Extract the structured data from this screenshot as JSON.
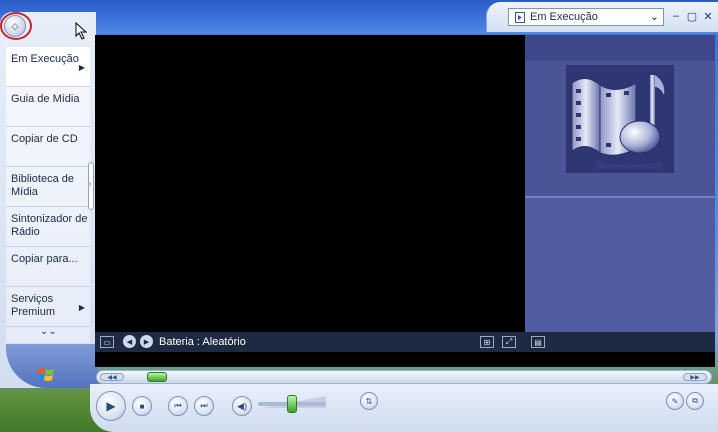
{
  "header": {
    "mode_selected": "Em Execução"
  },
  "taskpane": {
    "items": [
      {
        "label": "Em Execução",
        "has_arrow": true
      },
      {
        "label": "Guia de Mídia",
        "has_arrow": false
      },
      {
        "label": "Copiar de CD",
        "has_arrow": false
      },
      {
        "label": "Biblioteca de Mídia",
        "has_arrow": false
      },
      {
        "label": "Sintonizador de Rádio",
        "has_arrow": false
      },
      {
        "label": "Copiar para...",
        "has_arrow": false
      },
      {
        "label": "Serviços Premium",
        "has_arrow": true
      }
    ]
  },
  "infobar": {
    "now_playing": "Bateria : Aleatório"
  },
  "playback": {
    "seek_position": 0.04,
    "volume_level": 0.5
  },
  "colors": {
    "video_bg": "#000000",
    "visualization_panel": "#4a5496",
    "seek_thumb": "#3ea32a"
  },
  "icons": [
    "back-icon",
    "minimize-icon",
    "maximize-icon",
    "close-icon",
    "play-icon",
    "stop-icon",
    "previous-icon",
    "next-icon",
    "mute-icon",
    "windows-logo-icon"
  ]
}
